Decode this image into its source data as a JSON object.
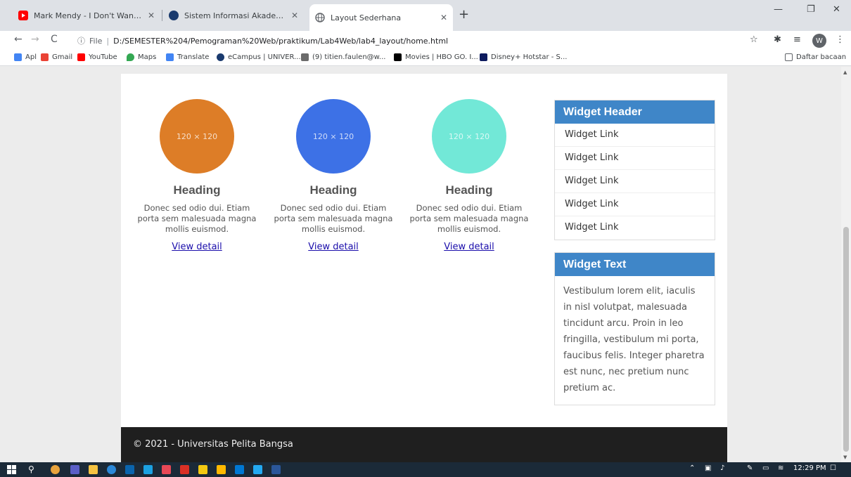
{
  "browser": {
    "tabs": [
      {
        "title": "Mark Mendy - I Don't Wanna Be",
        "favicon": "youtube-icon",
        "color": "#ff0000"
      },
      {
        "title": "Sistem Informasi Akademik",
        "favicon": "campus-icon",
        "color": "#1a3a6e"
      },
      {
        "title": "Layout Sederhana",
        "favicon": "globe-icon",
        "color": "#5f6368"
      }
    ],
    "url": {
      "scheme_label": "File",
      "path": "D:/SEMESTER%204/Pemograman%20Web/praktikum/Lab4Web/lab4_layout/home.html"
    },
    "bookmarks": [
      {
        "label": "Apl",
        "color": "#4285f4"
      },
      {
        "label": "Gmail",
        "color": "#ea4335"
      },
      {
        "label": "YouTube",
        "color": "#ff0000"
      },
      {
        "label": "Maps",
        "color": "#34a853"
      },
      {
        "label": "Translate",
        "color": "#4285f4"
      },
      {
        "label": "eCampus | UNIVER...",
        "color": "#1a3a6e"
      },
      {
        "label": "(9) titien.faulen@w...",
        "color": "#6b6b6b"
      },
      {
        "label": "Movies | HBO GO. I...",
        "color": "#000000"
      },
      {
        "label": "Disney+ Hotstar - S...",
        "color": "#0d1b5e"
      }
    ],
    "reading_list": "Daftar bacaan",
    "profile_initial": "W"
  },
  "page": {
    "cards": [
      {
        "placeholder": "120 × 120",
        "color": "#dd7d27",
        "heading": "Heading",
        "text": "Donec sed odio dui. Etiam porta sem malesuada magna mollis euismod.",
        "link": "View detail"
      },
      {
        "placeholder": "120 × 120",
        "color": "#3d71e6",
        "heading": "Heading",
        "text": "Donec sed odio dui. Etiam porta sem malesuada magna mollis euismod.",
        "link": "View detail"
      },
      {
        "placeholder": "120 × 120",
        "color": "#72e8d7",
        "heading": "Heading",
        "text": "Donec sed odio dui. Etiam porta sem malesuada magna mollis euismod.",
        "link": "View detail"
      }
    ],
    "widget_links": {
      "header": "Widget Header",
      "links": [
        "Widget Link",
        "Widget Link",
        "Widget Link",
        "Widget Link",
        "Widget Link"
      ]
    },
    "widget_text": {
      "header": "Widget Text",
      "body": "Vestibulum lorem elit, iaculis in nisl volutpat, malesuada tincidunt arcu. Proin in leo fringilla, vestibulum mi porta, faucibus felis. Integer pharetra est nunc, nec pretium nunc pretium ac."
    },
    "footer": "© 2021 - Universitas Pelita Bangsa"
  },
  "taskbar": {
    "time": "12:29 PM"
  },
  "colors": {
    "widget_header": "#3f86c8",
    "footer_bg": "#1f1f1f",
    "link": "#1a0dab"
  }
}
